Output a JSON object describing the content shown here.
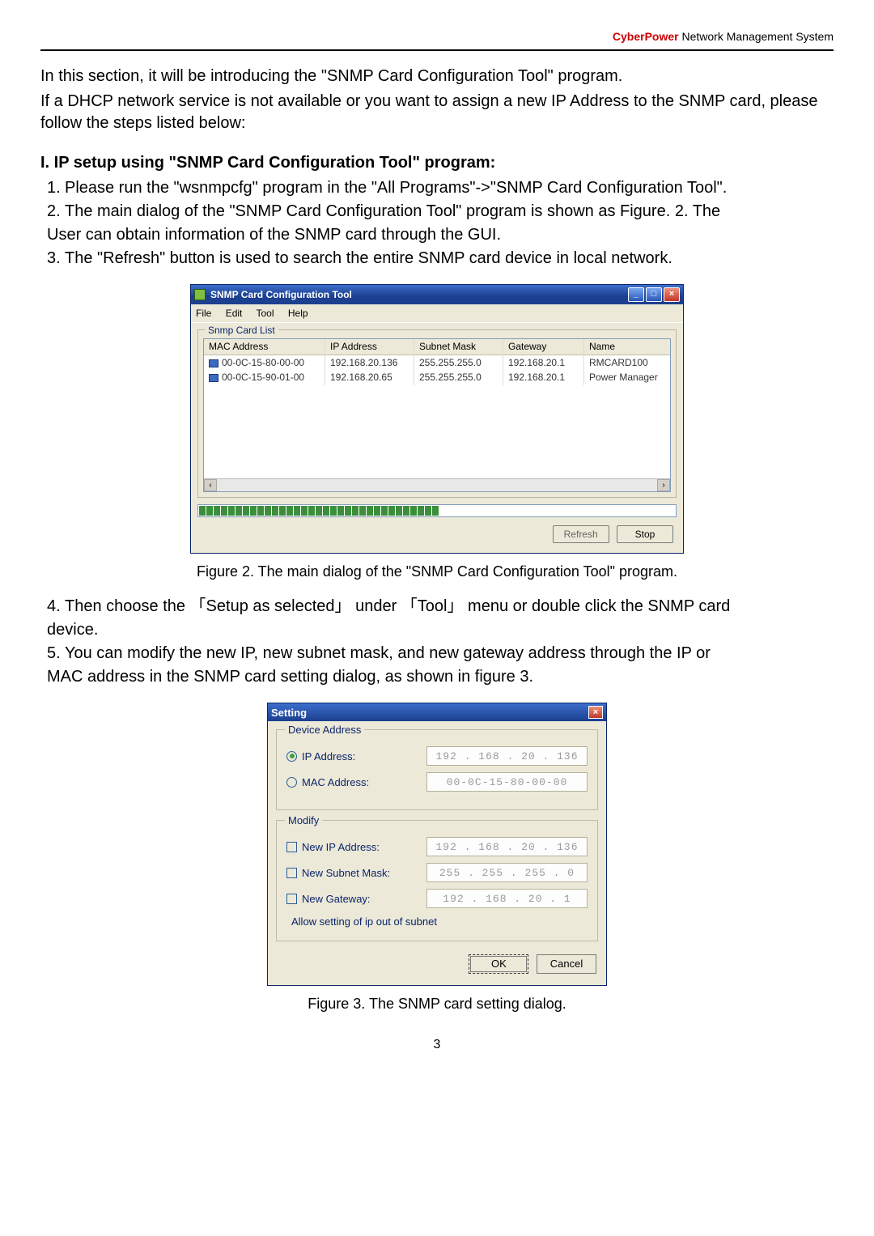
{
  "header": {
    "brand": "CyberPower",
    "rest": " Network Management System"
  },
  "intro": {
    "p1": "In this section, it will be introducing the \"SNMP Card Configuration Tool\" program.",
    "p2": "If a DHCP network service is not available or you want to assign a new IP Address to the SNMP card, please follow the steps listed below:"
  },
  "section1": {
    "title": "I. IP setup using \"SNMP Card Configuration Tool\" program:",
    "steps": {
      "1": "Please run the \"wsnmpcfg\" program in the \"All Programs\"->\"SNMP Card Configuration Tool\".",
      "2a": "The main dialog of the \"SNMP Card Configuration Tool\" program is shown as Figure. 2. The",
      "2b": "User can obtain information of the SNMP card through the GUI.",
      "3": "The \"Refresh\" button is used to search the entire SNMP card device in local network."
    }
  },
  "win1": {
    "title": "SNMP Card Configuration Tool",
    "menu": {
      "file": "File",
      "edit": "Edit",
      "tool": "Tool",
      "help": "Help"
    },
    "group": "Snmp Card List",
    "columns": {
      "mac": "MAC Address",
      "ip": "IP Address",
      "sub": "Subnet Mask",
      "gw": "Gateway",
      "nm": "Name"
    },
    "rows": [
      {
        "mac": "00-0C-15-80-00-00",
        "ip": "192.168.20.136",
        "sub": "255.255.255.0",
        "gw": "192.168.20.1",
        "nm": "RMCARD100"
      },
      {
        "mac": "00-0C-15-90-01-00",
        "ip": "192.168.20.65",
        "sub": "255.255.255.0",
        "gw": "192.168.20.1",
        "nm": "Power Manager"
      }
    ],
    "buttons": {
      "refresh": "Refresh",
      "stop": "Stop"
    }
  },
  "caption1": "Figure 2. The main dialog of the \"SNMP Card Configuration Tool\" program.",
  "section2": {
    "4a": "Then choose the 「Setup as selected」 under 「Tool」 menu or double click the SNMP card",
    "4b": "device.",
    "5a": "You can modify the new IP, new subnet mask, and new gateway address through the IP or",
    "5b": "MAC address in the SNMP card setting dialog, as shown in figure 3."
  },
  "dlg": {
    "title": "Setting",
    "group1": "Device Address",
    "ipaddr_label": "IP Address:",
    "mac_label": "MAC Address:",
    "ipaddr_val": "192 . 168 .  20 . 136",
    "mac_val": "00-0C-15-80-00-00",
    "group2": "Modify",
    "new_ip_label": "New IP Address:",
    "new_sub_label": "New Subnet Mask:",
    "new_gw_label": "New Gateway:",
    "new_ip_val": "192 . 168 .  20 . 136",
    "new_sub_val": "255 . 255 . 255 .   0",
    "new_gw_val": "192 . 168 .  20 .   1",
    "allow": "Allow setting of ip out of subnet",
    "ok": "OK",
    "cancel": "Cancel"
  },
  "caption2": "Figure 3. The SNMP card setting dialog.",
  "page_number": "3"
}
